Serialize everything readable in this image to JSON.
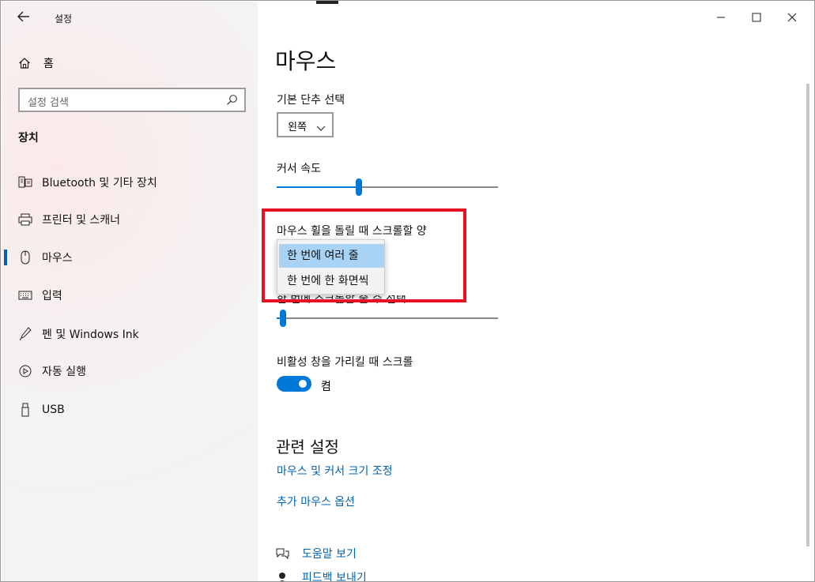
{
  "window": {
    "title": "설정"
  },
  "sidebar": {
    "home_label": "홈",
    "search_placeholder": "설정 검색",
    "section": "장치",
    "items": [
      {
        "label": "Bluetooth 및 기타 장치",
        "icon": "bluetooth-devices-icon"
      },
      {
        "label": "프린터 및 스캐너",
        "icon": "printer-icon"
      },
      {
        "label": "마우스",
        "icon": "mouse-icon",
        "active": true
      },
      {
        "label": "입력",
        "icon": "keyboard-icon"
      },
      {
        "label": "펜 및 Windows Ink",
        "icon": "pen-icon"
      },
      {
        "label": "자동 실행",
        "icon": "autoplay-icon"
      },
      {
        "label": "USB",
        "icon": "usb-icon"
      }
    ]
  },
  "main": {
    "title": "마우스",
    "primary_button": {
      "label": "기본 단추 선택",
      "value": "왼쪽"
    },
    "cursor_speed": {
      "label": "커서 속도",
      "value_fraction": 0.37
    },
    "scroll_amount": {
      "label": "마우스 휠을 돌릴 때 스크롤할 양",
      "options": [
        "한 번에 여러 줄",
        "한 번에 한 화면씩"
      ],
      "selected": "한 번에 여러 줄"
    },
    "lines_to_scroll": {
      "label": "한 번에 스크롤할 줄 수 선택",
      "value_fraction": 0.03
    },
    "inactive_scroll": {
      "label": "비활성 창을 가리킬 때 스크롤",
      "state": "켬",
      "on": true
    },
    "related": {
      "title": "관련 설정",
      "links": [
        "마우스 및 커서 크기 조정",
        "추가 마우스 옵션"
      ]
    },
    "help": [
      {
        "label": "도움말 보기",
        "icon": "help-chat-icon"
      },
      {
        "label": "피드백 보내기",
        "icon": "feedback-icon"
      }
    ]
  },
  "colors": {
    "accent": "#0078d7",
    "link": "#0063b1",
    "highlight_box": "#e81123"
  }
}
